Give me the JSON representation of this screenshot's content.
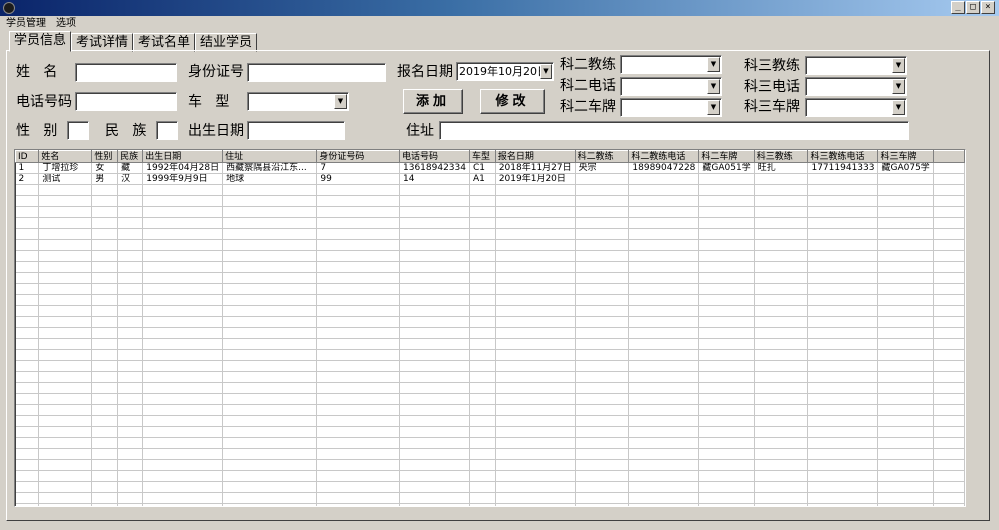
{
  "window": {
    "min_glyph": "_",
    "max_glyph": "□",
    "close_glyph": "×"
  },
  "menu": [
    "学员管理",
    "选项"
  ],
  "tabs": [
    "学员信息",
    "考试详情",
    "考试名单",
    "结业学员"
  ],
  "form": {
    "name_label": "姓   名",
    "idcard_label": "身份证号",
    "phone_label": "电话号码",
    "cartype_label": "车   型",
    "gender_label": "性   别",
    "ethnic_label": "民   族",
    "birth_label": "出生日期",
    "regdate_label": "报名日期",
    "regdate_value": "2019年10月20日",
    "address_label": "住址",
    "k2_coach_label": "科二教练",
    "k2_phone_label": "科二电话",
    "k2_plate_label": "科二车牌",
    "k3_coach_label": "科三教练",
    "k3_phone_label": "科三电话",
    "k3_plate_label": "科三车牌",
    "add_button": "添加",
    "modify_button": "修改",
    "combo_arrow": "▼"
  },
  "table": {
    "columns": [
      "ID",
      "姓名",
      "性别",
      "民族",
      "出生日期",
      "住址",
      "身份证号码",
      "电话号码",
      "车型",
      "报名日期",
      "科二教练",
      "科二教练电话",
      "科二车牌",
      "科三教练",
      "科三教练电话",
      "科三车牌",
      ""
    ],
    "rows": [
      [
        "1",
        "丁增拉珍",
        "女",
        "藏",
        "1992年04月28日",
        "西藏察隅县沿江东...",
        "7",
        "13618942334",
        "C1",
        "2018年11月27日",
        "央宗",
        "18989047228",
        "藏GA051学",
        "旺扎",
        "17711941333",
        "藏GA075学",
        ""
      ],
      [
        "2",
        "测试",
        "男",
        "汉",
        "1999年9月9日",
        "地球",
        "99",
        "14",
        "A1",
        "2019年1月20日",
        "",
        "",
        "",
        "",
        "",
        "",
        ""
      ]
    ],
    "empty_rows": 30
  }
}
